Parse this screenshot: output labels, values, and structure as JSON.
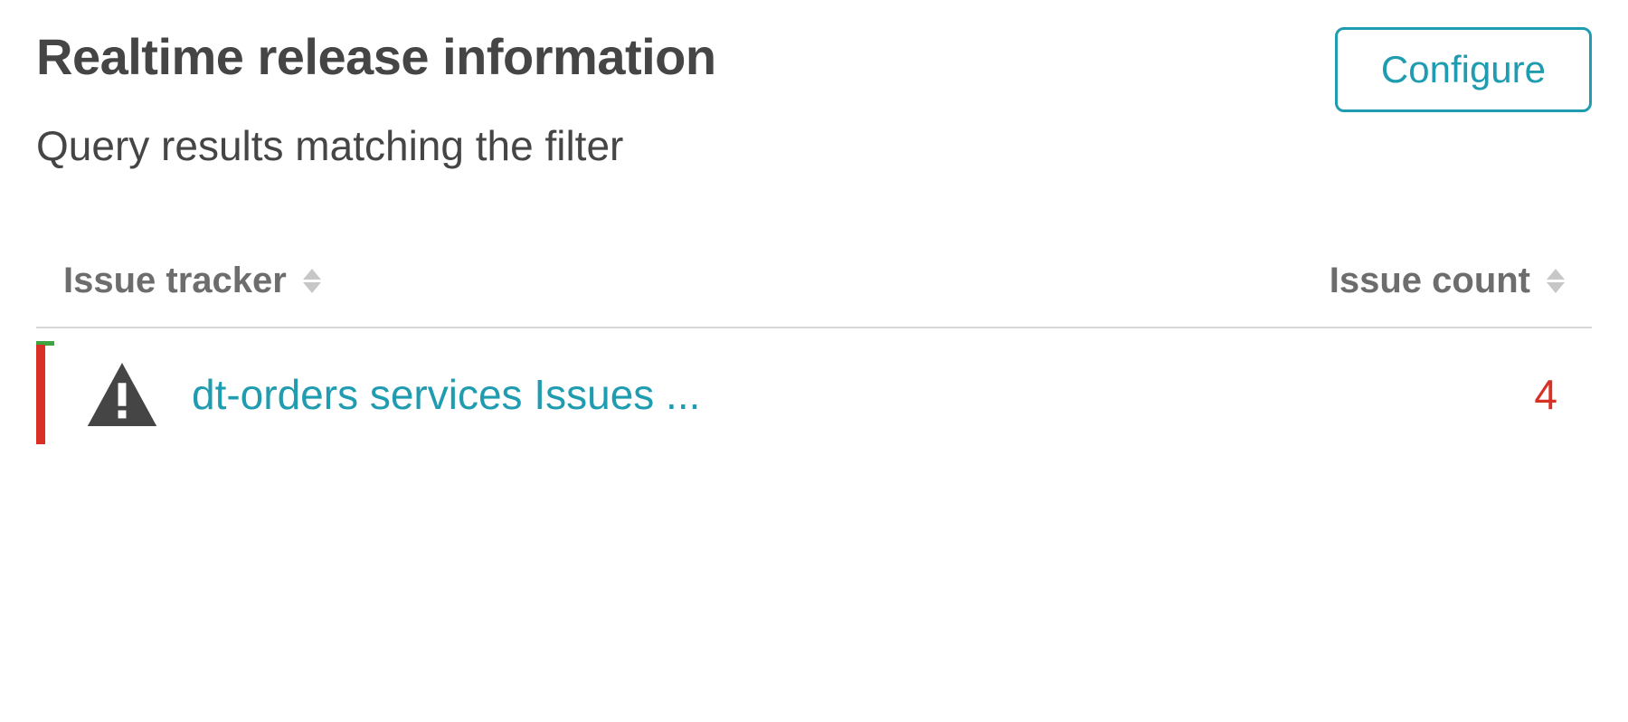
{
  "header": {
    "title": "Realtime release information",
    "subtitle": "Query results matching the filter",
    "configure_label": "Configure"
  },
  "table": {
    "columns": {
      "tracker_label": "Issue tracker",
      "count_label": "Issue count"
    },
    "row": {
      "tracker_name": "dt-orders services Issues ...",
      "issue_count": "4"
    }
  }
}
